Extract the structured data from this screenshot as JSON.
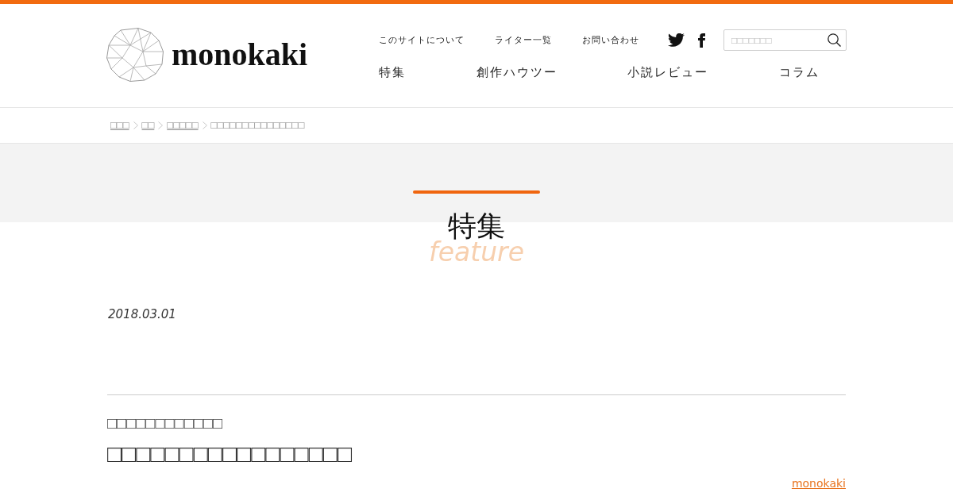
{
  "header": {
    "logo": {
      "text": "monokaki"
    },
    "utility_links": [
      "このサイトについて",
      "ライター一覧",
      "お問い合わせ"
    ],
    "search": {
      "placeholder": "□□□□□□□"
    },
    "main_nav": [
      "特集",
      "創作ハウツー",
      "小説レビュー",
      "コラム"
    ]
  },
  "breadcrumb": [
    {
      "label": "□□□",
      "kind": "link"
    },
    {
      "label": "□□",
      "kind": "link"
    },
    {
      "label": "□□□□□",
      "kind": "link"
    },
    {
      "label": "□□□□□□□□□□□□□□□",
      "kind": "current"
    }
  ],
  "page_heading": {
    "title": "特集",
    "subtitle": "feature"
  },
  "article": {
    "date": "2018.03.01",
    "subtitle": "□□□□□□□□□□□□",
    "title": "□□□□□□□□□□□□□□□□□",
    "author": "monokaki"
  }
}
